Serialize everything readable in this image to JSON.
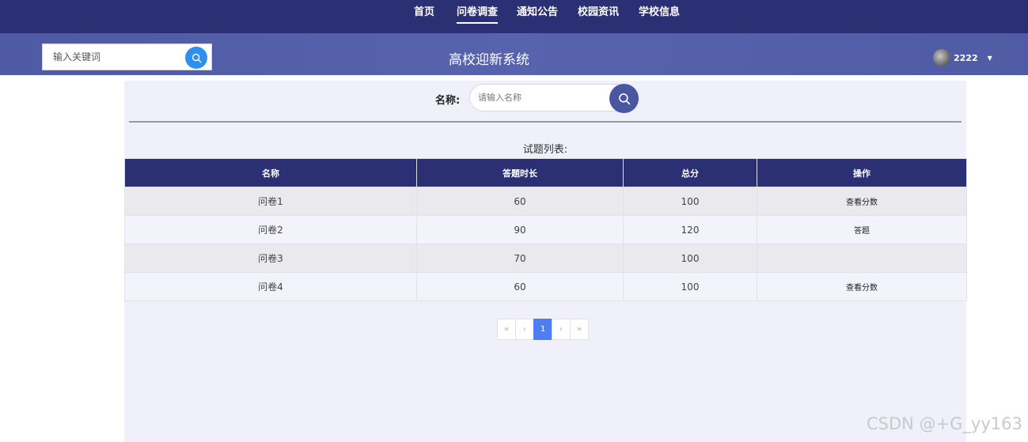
{
  "nav": {
    "items": [
      {
        "label": "首页"
      },
      {
        "label": "问卷调查"
      },
      {
        "label": "通知公告"
      },
      {
        "label": "校园资讯"
      },
      {
        "label": "学校信息"
      }
    ],
    "active": "问卷调查"
  },
  "header": {
    "search_placeholder": "输入关键词",
    "title": "高校迎新系统",
    "username": "2222"
  },
  "filter": {
    "label": "名称:",
    "placeholder": "请输入名称"
  },
  "list": {
    "title": "试题列表:",
    "columns": [
      "名称",
      "答题时长",
      "总分",
      "操作"
    ],
    "rows": [
      {
        "name": "问卷1",
        "duration": "60",
        "score": "100",
        "action": "查看分数"
      },
      {
        "name": "问卷2",
        "duration": "90",
        "score": "120",
        "action": "答题"
      },
      {
        "name": "问卷3",
        "duration": "70",
        "score": "100",
        "action": ""
      },
      {
        "name": "问卷4",
        "duration": "60",
        "score": "100",
        "action": "查看分数"
      }
    ]
  },
  "pagination": {
    "first": "«",
    "prev": "‹",
    "current": "1",
    "next": "›",
    "last": "»"
  },
  "watermark": "CSDN @+G_yy163",
  "colors": {
    "nav_bg": "#2b2f73",
    "header_bg": "#5460a9",
    "search_accent": "#2f8ff0",
    "page_active": "#4d7ef2"
  }
}
